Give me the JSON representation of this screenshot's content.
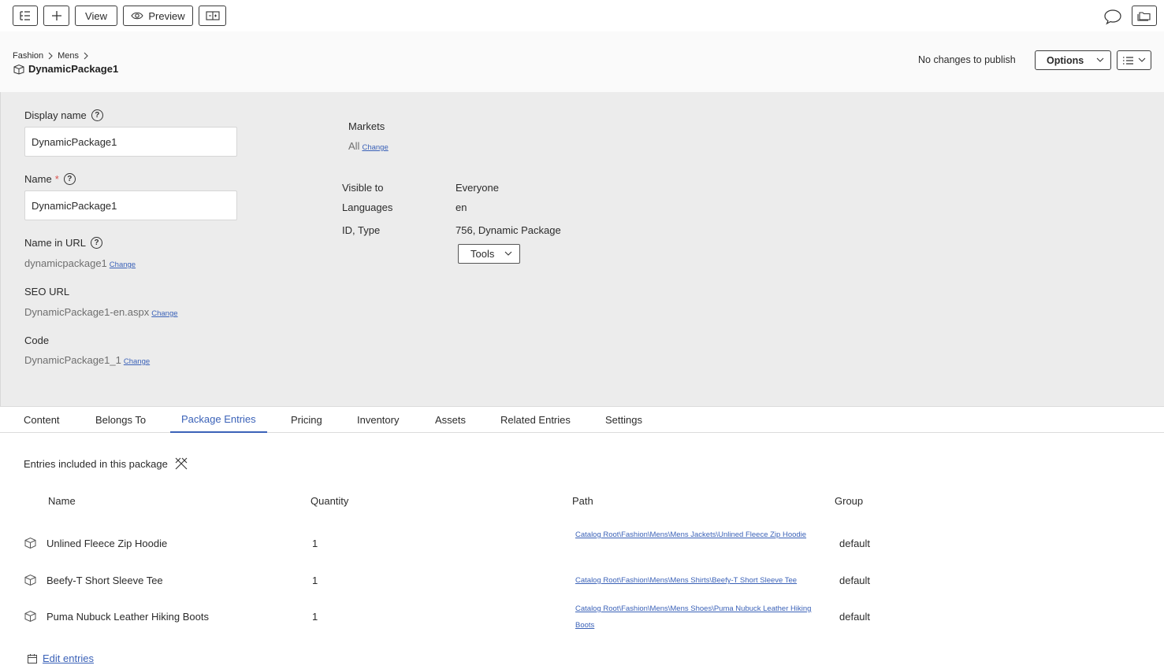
{
  "toolbar": {
    "view_label": "View",
    "preview_label": "Preview"
  },
  "header": {
    "breadcrumb": [
      "Fashion",
      "Mens"
    ],
    "title": "DynamicPackage1",
    "publish_status": "No changes to publish",
    "options_label": "Options"
  },
  "properties": {
    "display_name": {
      "label": "Display name",
      "value": "DynamicPackage1"
    },
    "name": {
      "label": "Name",
      "required_mark": "*",
      "value": "DynamicPackage1"
    },
    "name_in_url": {
      "label": "Name in URL",
      "value": "dynamicpackage1",
      "change": "Change"
    },
    "seo_url": {
      "label": "SEO URL",
      "value": "DynamicPackage1-en.aspx",
      "change": "Change"
    },
    "code": {
      "label": "Code",
      "value": "DynamicPackage1_1",
      "change": "Change"
    },
    "markets": {
      "label": "Markets",
      "value": "All",
      "change": "Change"
    },
    "visible_to": {
      "label": "Visible to",
      "value": "Everyone"
    },
    "languages": {
      "label": "Languages",
      "value": "en"
    },
    "id_type": {
      "label": "ID, Type",
      "value": "756, Dynamic Package"
    },
    "tools_label": "Tools"
  },
  "tabs": [
    "Content",
    "Belongs To",
    "Package Entries",
    "Pricing",
    "Inventory",
    "Assets",
    "Related Entries",
    "Settings"
  ],
  "active_tab": "Package Entries",
  "entries": {
    "title": "Entries included in this package",
    "columns": [
      "Name",
      "Quantity",
      "Path",
      "Group"
    ],
    "rows": [
      {
        "name": "Unlined Fleece Zip Hoodie",
        "quantity": "1",
        "path": "Catalog Root\\Fashion\\Mens\\Mens Jackets\\Unlined Fleece Zip Hoodie",
        "group": "default"
      },
      {
        "name": "Beefy-T Short Sleeve Tee",
        "quantity": "1",
        "path": "Catalog Root\\Fashion\\Mens\\Mens Shirts\\Beefy-T Short Sleeve Tee",
        "group": "default"
      },
      {
        "name": "Puma Nubuck Leather Hiking Boots",
        "quantity": "1",
        "path": "Catalog Root\\Fashion\\Mens\\Mens Shoes\\Puma Nubuck Leather Hiking Boots",
        "group": "default"
      }
    ],
    "edit_label": "Edit entries"
  },
  "colors": {
    "accent": "#3b62b8",
    "panel_bg": "#ececec",
    "required": "#d9534f"
  }
}
